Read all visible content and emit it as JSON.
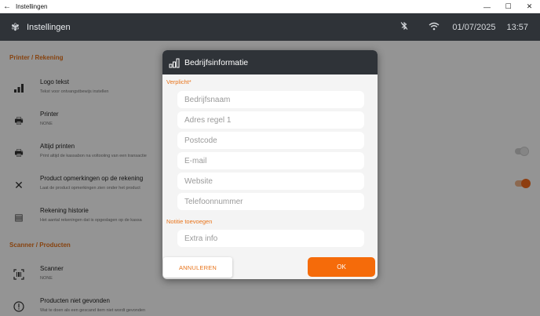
{
  "window": {
    "title": "Instellingen",
    "controls": {
      "minimize": "—",
      "maximize": "☐",
      "close": "✕"
    }
  },
  "header": {
    "title": "Instellingen",
    "date": "01/07/2025",
    "time": "13:57"
  },
  "background": {
    "sections": [
      {
        "title": "Printer / Rekening"
      },
      {
        "title": "Scanner / Producten"
      }
    ],
    "settings": [
      {
        "label": "Logo tekst",
        "sub": "Tekst voor ontvangstbewijs instellen"
      },
      {
        "label": "Printer",
        "sub": "NONE"
      },
      {
        "label": "Altijd printen",
        "sub": "Print altijd de kassabon na voltooiing van een transactie"
      },
      {
        "label": "Product opmerkingen op de rekening",
        "sub": "Laat de product opmerkingen zien onder het product"
      },
      {
        "label": "Rekening historie",
        "sub": "Het aantal rekeningen dat is opgeslagen op de kassa"
      },
      {
        "label": "Scanner",
        "sub": "NONE"
      },
      {
        "label": "Producten niet gevonden",
        "sub": "Wat te doen als een gescand item niet wordt gevonden"
      }
    ],
    "toggles": {
      "altijd_printen": "off",
      "product_opmerkingen": "on"
    }
  },
  "dialog": {
    "title": "Bedrijfsinformatie",
    "required_label": "Verplicht*",
    "notes_label": "Notitie toevoegen",
    "fields": {
      "company_name": "Bedrijfsnaam",
      "address": "Adres regel 1",
      "postcode": "Postcode",
      "email": "E-mail",
      "website": "Website",
      "phone": "Telefoonnummer",
      "extra": "Extra info"
    },
    "cancel_label": "ANNULEREN",
    "ok_label": "OK"
  },
  "colors": {
    "accent": "#F56B0A",
    "header_bg": "#2F3338",
    "section_title": "#E8741B"
  }
}
